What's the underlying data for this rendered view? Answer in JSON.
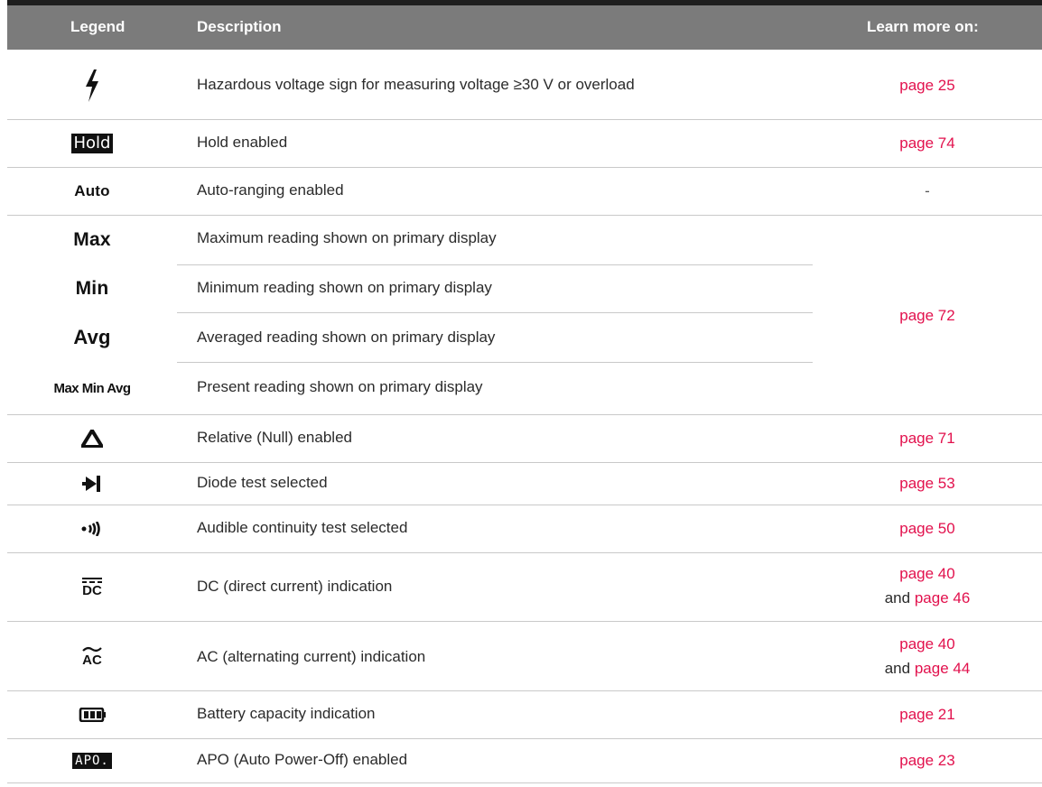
{
  "header": {
    "legend": "Legend",
    "description": "Description",
    "learn_more": "Learn more on:"
  },
  "rows": [
    {
      "icon": "hazard-voltage-icon",
      "legend_text": "",
      "description": "Hazardous voltage sign for measuring voltage ≥30 V or overload",
      "ref": [
        "page 25"
      ]
    },
    {
      "icon": "hold-icon",
      "legend_text": "Hold",
      "description": "Hold enabled",
      "ref": [
        "page 74"
      ]
    },
    {
      "icon": "auto-icon",
      "legend_text": "Auto",
      "description": "Auto-ranging enabled",
      "ref": [
        "-"
      ]
    },
    {
      "icon": "max-icon",
      "legend_text": "Max",
      "description": "Maximum reading shown on primary display",
      "ref": []
    },
    {
      "icon": "min-icon",
      "legend_text": "Min",
      "description": "Minimum reading shown on primary display",
      "ref": [
        "page 72"
      ]
    },
    {
      "icon": "avg-icon",
      "legend_text": "Avg",
      "description": "Averaged reading shown on primary display",
      "ref": []
    },
    {
      "icon": "max-min-avg-icon",
      "legend_text": "Max Min Avg",
      "description": "Present reading shown on primary display",
      "ref": []
    },
    {
      "icon": "delta-icon",
      "legend_text": "",
      "description": "Relative (Null) enabled",
      "ref": [
        "page 71"
      ]
    },
    {
      "icon": "diode-icon",
      "legend_text": "",
      "description": "Diode test selected",
      "ref": [
        "page 53"
      ]
    },
    {
      "icon": "continuity-icon",
      "legend_text": "",
      "description": "Audible continuity test selected",
      "ref": [
        "page 50"
      ]
    },
    {
      "icon": "dc-icon",
      "legend_text": "DC",
      "description": "DC (direct current) indication",
      "ref": [
        "page 40",
        "page 46"
      ],
      "ref_joiner": "and"
    },
    {
      "icon": "ac-icon",
      "legend_text": "AC",
      "description": "AC (alternating current) indication",
      "ref": [
        "page 40",
        "page 44"
      ],
      "ref_joiner": "and"
    },
    {
      "icon": "battery-icon",
      "legend_text": "",
      "description": "Battery capacity indication",
      "ref": [
        "page 21"
      ]
    },
    {
      "icon": "apo-icon",
      "legend_text": "APO.",
      "description": "APO (Auto Power-Off) enabled",
      "ref": [
        "page 23"
      ]
    }
  ],
  "colors": {
    "header_bg": "#7b7b7b",
    "link": "#e2114d",
    "rule": "#c9c9c9"
  }
}
